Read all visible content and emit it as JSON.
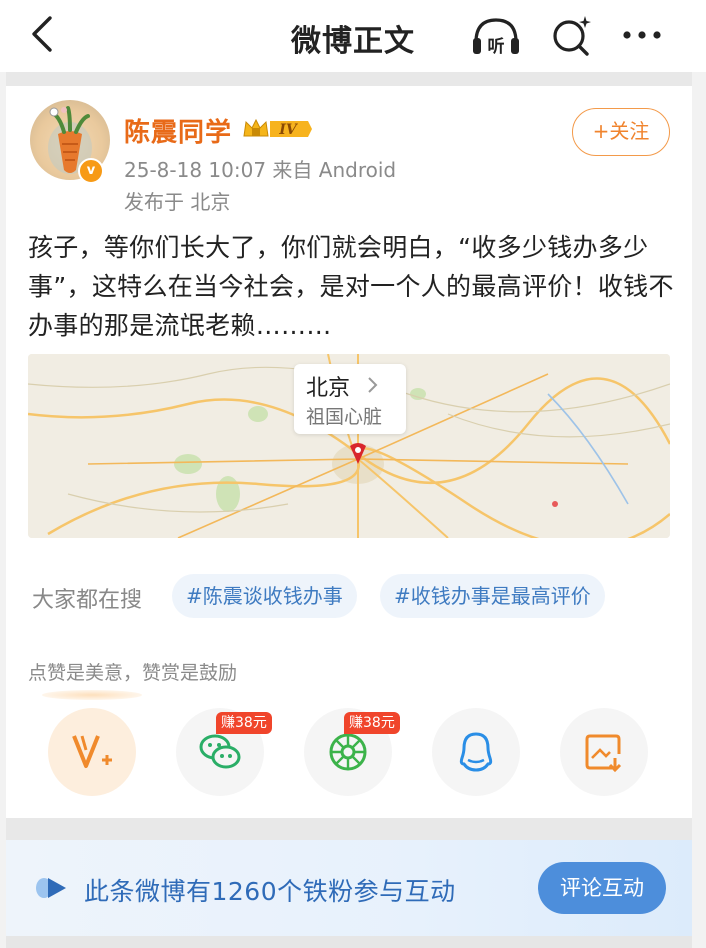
{
  "header": {
    "title": "微博正文",
    "listen_label": "听"
  },
  "post": {
    "author": "陈震同学",
    "level": "IV",
    "verified_badge": "v",
    "time_source": "25-8-18 10:07  来自 Android",
    "location_line": "发布于 北京",
    "follow_label": "+关注",
    "text": "孩子，等你们长大了，你们就会明白，“收多少钱办多少事”，这特么在当今社会，是对一个人的最高评价！收钱不办事的那是流氓老赖………",
    "map": {
      "city": "北京",
      "subtitle": "祖国心脏"
    }
  },
  "trending": {
    "label": "大家都在搜",
    "tags": [
      "#陈震谈收钱办事",
      "#收钱办事是最高评价"
    ]
  },
  "reward": {
    "hint": "点赞是美意，赞赏是鼓励",
    "earn_badges": [
      "赚38元",
      "赚38元"
    ],
    "icons": [
      "v-plus-icon",
      "wechat-icon",
      "moments-icon",
      "qq-icon",
      "save-image-icon"
    ]
  },
  "fan_bar": {
    "text": "此条微博有1260个铁粉参与互动",
    "button": "评论互动"
  },
  "colors": {
    "accent_orange": "#e86a18",
    "link_blue": "#3f7bc1",
    "button_blue": "#4d8edb",
    "earn_red": "#f0452b"
  }
}
